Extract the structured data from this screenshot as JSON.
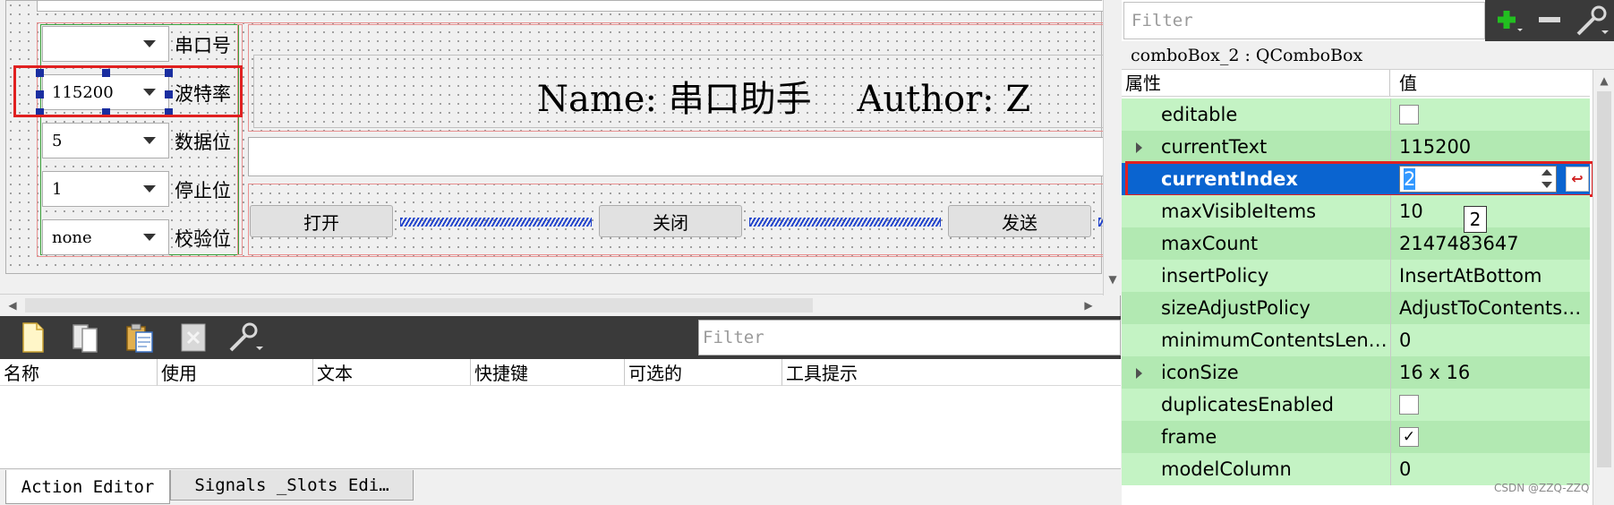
{
  "form": {
    "port_combo_value": "",
    "port_label": "串口号",
    "baud_combo_value": "115200",
    "baud_label": "波特率",
    "data_combo_value": "5",
    "data_label": "数据位",
    "stop_combo_value": "1",
    "stop_label": "停止位",
    "parity_combo_value": "none",
    "parity_label": "校验位",
    "header_text": "Name: 串口助手    Author: Z",
    "open_button": "打开",
    "close_button": "关闭",
    "send_button": "发送"
  },
  "action_editor": {
    "filter_placeholder": "Filter",
    "columns": [
      "名称",
      "使用",
      "文本",
      "快捷键",
      "可选的",
      "工具提示"
    ],
    "tabs": [
      "Action Editor",
      "Signals _Slots Edi…"
    ]
  },
  "property_editor": {
    "filter_placeholder": "Filter",
    "object_title": "comboBox_2 : QComboBox",
    "header_property": "属性",
    "header_value": "值",
    "rows": [
      {
        "name": "editable",
        "value": "",
        "type": "checkbox",
        "checked": false,
        "expandable": false
      },
      {
        "name": "currentText",
        "value": "115200",
        "type": "text",
        "expandable": true
      },
      {
        "name": "currentIndex",
        "value": "2",
        "type": "spin",
        "expandable": false,
        "selected": true
      },
      {
        "name": "maxVisibleItems",
        "value": "10",
        "type": "text",
        "expandable": false
      },
      {
        "name": "maxCount",
        "value": "2147483647",
        "type": "text",
        "expandable": false
      },
      {
        "name": "insertPolicy",
        "value": "InsertAtBottom",
        "type": "text",
        "expandable": false
      },
      {
        "name": "sizeAdjustPolicy",
        "value": "AdjustToContents…",
        "type": "text",
        "expandable": false
      },
      {
        "name": "minimumContentsLen…",
        "value": "0",
        "type": "text",
        "expandable": false
      },
      {
        "name": "iconSize",
        "value": "16 x 16",
        "type": "text",
        "expandable": true
      },
      {
        "name": "duplicatesEnabled",
        "value": "",
        "type": "checkbox",
        "checked": false,
        "expandable": false
      },
      {
        "name": "frame",
        "value": "✓",
        "type": "checkbox",
        "checked": true,
        "expandable": false
      },
      {
        "name": "modelColumn",
        "value": "0",
        "type": "text",
        "expandable": false
      }
    ],
    "tooltip_text": "2"
  },
  "watermark": "CSDN @ZZQ-ZZQ",
  "colors": {
    "selection_blue": "#0a64d0",
    "highlight_red": "#e02020",
    "row_green_light": "#c4f3c4",
    "row_green_dark": "#b2e9b2",
    "toolbar_dark": "#3a3a3a"
  },
  "icons": [
    "new-action-icon",
    "copy-icon",
    "paste-icon",
    "delete-icon",
    "wrench-icon",
    "plus-icon",
    "minus-icon",
    "spanner-icon"
  ]
}
